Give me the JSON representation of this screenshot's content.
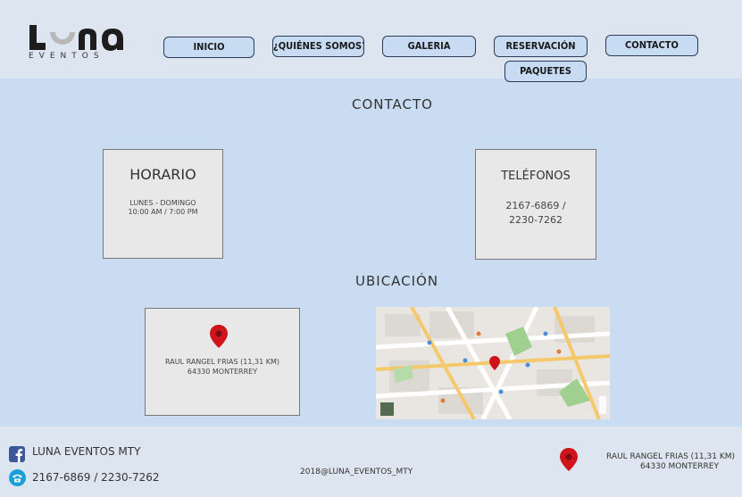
{
  "logo": {
    "word": "LUNA",
    "sub": "EVENTOS"
  },
  "nav": {
    "inicio": "INICIO",
    "quienes": "¿QUIÉNES SOMOS?",
    "galeria": "GALERIA",
    "reservacion": "RESERVACIÓN",
    "paquetes": "PAQUETES",
    "contacto": "CONTACTO"
  },
  "contact": {
    "title": "CONTACTO",
    "horario": {
      "title": "HORARIO",
      "line1": "LUNES - DOMINGO",
      "line2": "10:00 AM / 7:00 PM"
    },
    "telefonos": {
      "title": "TELÉFONOS",
      "line1": "2167-6869 /",
      "line2": "2230-7262"
    }
  },
  "location": {
    "title": "UBICACIÓN",
    "address_line1": "RAUL RANGEL FRIAS (11,31 KM)",
    "address_line2": "64330 MONTERREY"
  },
  "footer": {
    "facebook": "LUNA EVENTOS MTY",
    "phone": "2167-6869 / 2230-7262",
    "email": "2018@LUNA_EVENTOS_MTY",
    "address_line1": "RAUL RANGEL FRIAS (11,31 KM)",
    "address_line2": "64330 MONTERREY"
  },
  "colors": {
    "page_bg": "#c9dcf2",
    "header_bg": "#dde6f0",
    "button_bg": "#c7dbf3",
    "pin_red": "#d0141c",
    "facebook_blue": "#3b5998",
    "phone_teal": "#1a9fd8"
  }
}
